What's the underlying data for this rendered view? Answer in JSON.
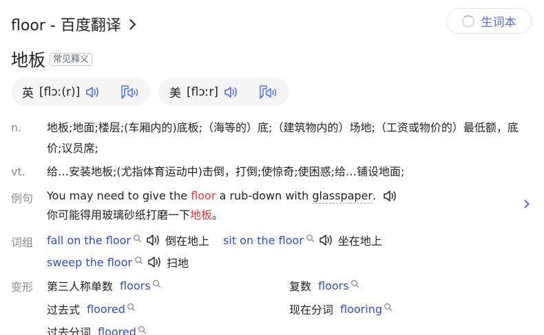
{
  "header": {
    "title": "floor - 百度翻译",
    "vocab_button": "生词本"
  },
  "word": {
    "headword": "地板",
    "tag": "常见释义"
  },
  "pronunciations": [
    {
      "region": "英",
      "phonetic": "[flɔː(r)]"
    },
    {
      "region": "美",
      "phonetic": "[flɔːr]"
    }
  ],
  "definitions": [
    {
      "pos": "n.",
      "text": "地板;地面;楼层;(车厢内的)底板;（海等的）底;（建筑物内的）场地;（工资或物价的）最低额，底价;议员席;"
    },
    {
      "pos": "vt.",
      "text": "给…安装地板;(尤指体育运动中)击倒，打倒;使惊奇;使困惑;给…铺设地面;"
    }
  ],
  "example": {
    "label": "例句",
    "en_before": "You may need to give the",
    "en_highlight": "floor",
    "en_middle": "a rub-down with",
    "en_linked": "glasspaper",
    "en_end": ".",
    "zh_before": "你可能得用玻璃砂纸打磨一下",
    "zh_highlight": "地板",
    "zh_end": "。"
  },
  "phrases": {
    "label": "词组",
    "items": [
      {
        "en": "fall on the floor",
        "zh": "倒在地上"
      },
      {
        "en": "sit on the floor",
        "zh": "坐在地上"
      },
      {
        "en": "sweep the floor",
        "zh": "扫地"
      }
    ]
  },
  "inflections": {
    "label": "变形",
    "items": [
      {
        "key": "第三人称单数",
        "value": "floors"
      },
      {
        "key": "复数",
        "value": "floors"
      },
      {
        "key": "过去式",
        "value": "floored"
      },
      {
        "key": "现在分词",
        "value": "flooring"
      },
      {
        "key": "过去分词",
        "value": "floored"
      }
    ]
  },
  "colors": {
    "accent": "#4e6ef2",
    "link": "#2a4dd6",
    "highlight": "#f73131",
    "muted": "#8a8d96"
  }
}
